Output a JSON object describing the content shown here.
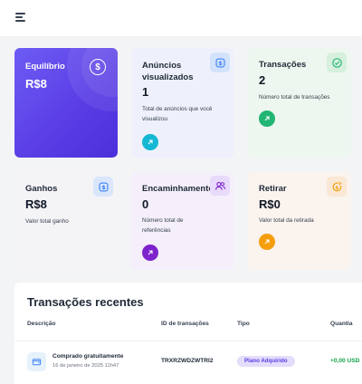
{
  "colors": {
    "primary": "#5b3ee6",
    "green": "#22b573",
    "teal": "#14b8d4",
    "purple": "#7e22ce",
    "orange": "#f59e0b",
    "amount_positive": "#16a34a"
  },
  "header": {
    "menu_icon": "hamburger-menu-icon"
  },
  "cards": {
    "balance": {
      "title": "Equilíbrio",
      "value": "R$8",
      "icon": "dollar-coin-icon",
      "icon_glyph": "$"
    },
    "ads": {
      "title_line1": "Anúncios",
      "title_line2": "visualizados",
      "value": "1",
      "desc_line1": "Total de anúncios que você",
      "desc_line2": "visualizou",
      "icon": "dollar-badge-icon",
      "action_icon": "arrow-up-right-icon"
    },
    "transactions": {
      "title": "Transações",
      "value": "2",
      "desc": "Número total de transações",
      "icon": "check-circle-icon",
      "action_icon": "arrow-up-right-icon"
    },
    "earnings": {
      "title": "Ganhos",
      "value": "R$8",
      "desc": "Valor total ganho",
      "icon": "dollar-badge-icon"
    },
    "referrals": {
      "title": "Encaminhamento",
      "value": "0",
      "desc_line1": "Número total de",
      "desc_line2": "referências",
      "icon": "users-icon",
      "action_icon": "arrow-up-right-icon"
    },
    "withdraw": {
      "title": "Retirar",
      "value": "R$0",
      "desc": "Valor total da retirada",
      "icon": "coin-refresh-icon",
      "action_icon": "arrow-up-right-icon"
    }
  },
  "recent": {
    "title": "Transações recentes",
    "columns": [
      "Descrição",
      "ID de transações",
      "Tipo",
      "Quantia"
    ],
    "rows": [
      {
        "icon": "wallet-icon",
        "description": "Comprado gratuitamente",
        "date": "16 de janeiro de 2025 11h47",
        "id": "TRXRZWDZWTRI2",
        "type": "Plano Adquirido",
        "amount": "+0,00 USD"
      }
    ]
  }
}
